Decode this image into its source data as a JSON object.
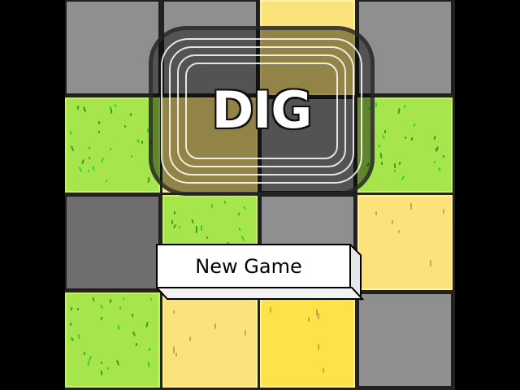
{
  "game": {
    "logo_text": "DIG",
    "new_game_label": "New Game"
  },
  "board": {
    "rows": 4,
    "cols": 4,
    "tiles": [
      [
        "stone",
        "stone",
        "sand",
        "stone"
      ],
      [
        "grass",
        "sand",
        "stone",
        "grass"
      ],
      [
        "stone",
        "grass",
        "stone",
        "sand"
      ],
      [
        "grass",
        "sand",
        "sand",
        "stone"
      ]
    ]
  },
  "colors": {
    "stone": "#8f8f8f",
    "grass": "#a7e54c",
    "sand": "#fbe27a",
    "background": "#000000"
  }
}
